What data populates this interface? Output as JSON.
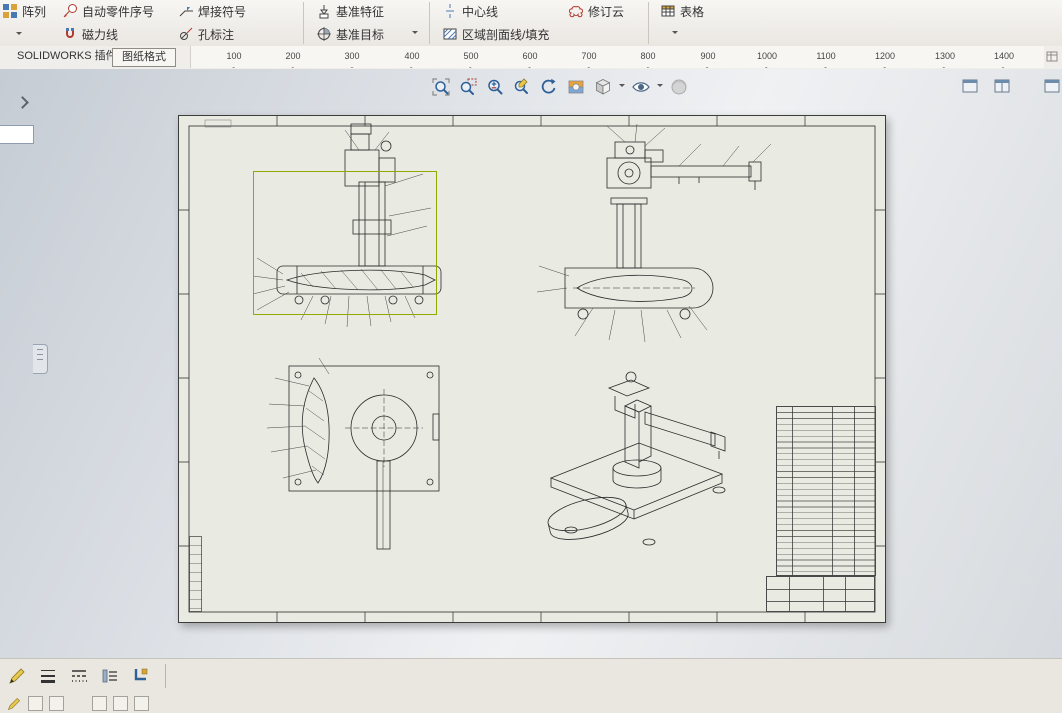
{
  "ribbon": {
    "row1": [
      {
        "label": "阵列"
      },
      {
        "label": "自动零件序号"
      },
      {
        "label": "焊接符号"
      },
      {
        "label": "基准特征"
      },
      {
        "label": "中心线"
      },
      {
        "label": "修订云"
      },
      {
        "label": "表格"
      }
    ],
    "row2": [
      {
        "label": "磁力线"
      },
      {
        "label": "孔标注"
      },
      {
        "label": "基准目标"
      },
      {
        "label": "区域剖面线/填充"
      }
    ]
  },
  "tabs": [
    {
      "label": "SOLIDWORKS 插件"
    },
    {
      "label": "图纸格式"
    }
  ],
  "ruler": {
    "ticks": [
      "100",
      "200",
      "300",
      "400",
      "500",
      "600",
      "700",
      "800",
      "900",
      "1000",
      "1100",
      "1200",
      "1300",
      "1400"
    ]
  },
  "icons": {
    "view_toolbar": [
      "zoom-to-fit",
      "zoom-area",
      "zoom-in-out",
      "zoom-to-selection",
      "rotate-view",
      "apply-scene",
      "display-style",
      "hide-show-items",
      "view-settings"
    ],
    "bottom_toolbar": [
      "line-format",
      "line-thickness",
      "line-style",
      "hide-show-edges",
      "layer"
    ]
  },
  "drawing": {
    "views": [
      "front-section-view",
      "side-view",
      "top-view",
      "isometric-view"
    ]
  },
  "colors": {
    "selection_green": "#93a702",
    "sheet": "#e9eae2",
    "accent_blue": "#2e5f96"
  }
}
